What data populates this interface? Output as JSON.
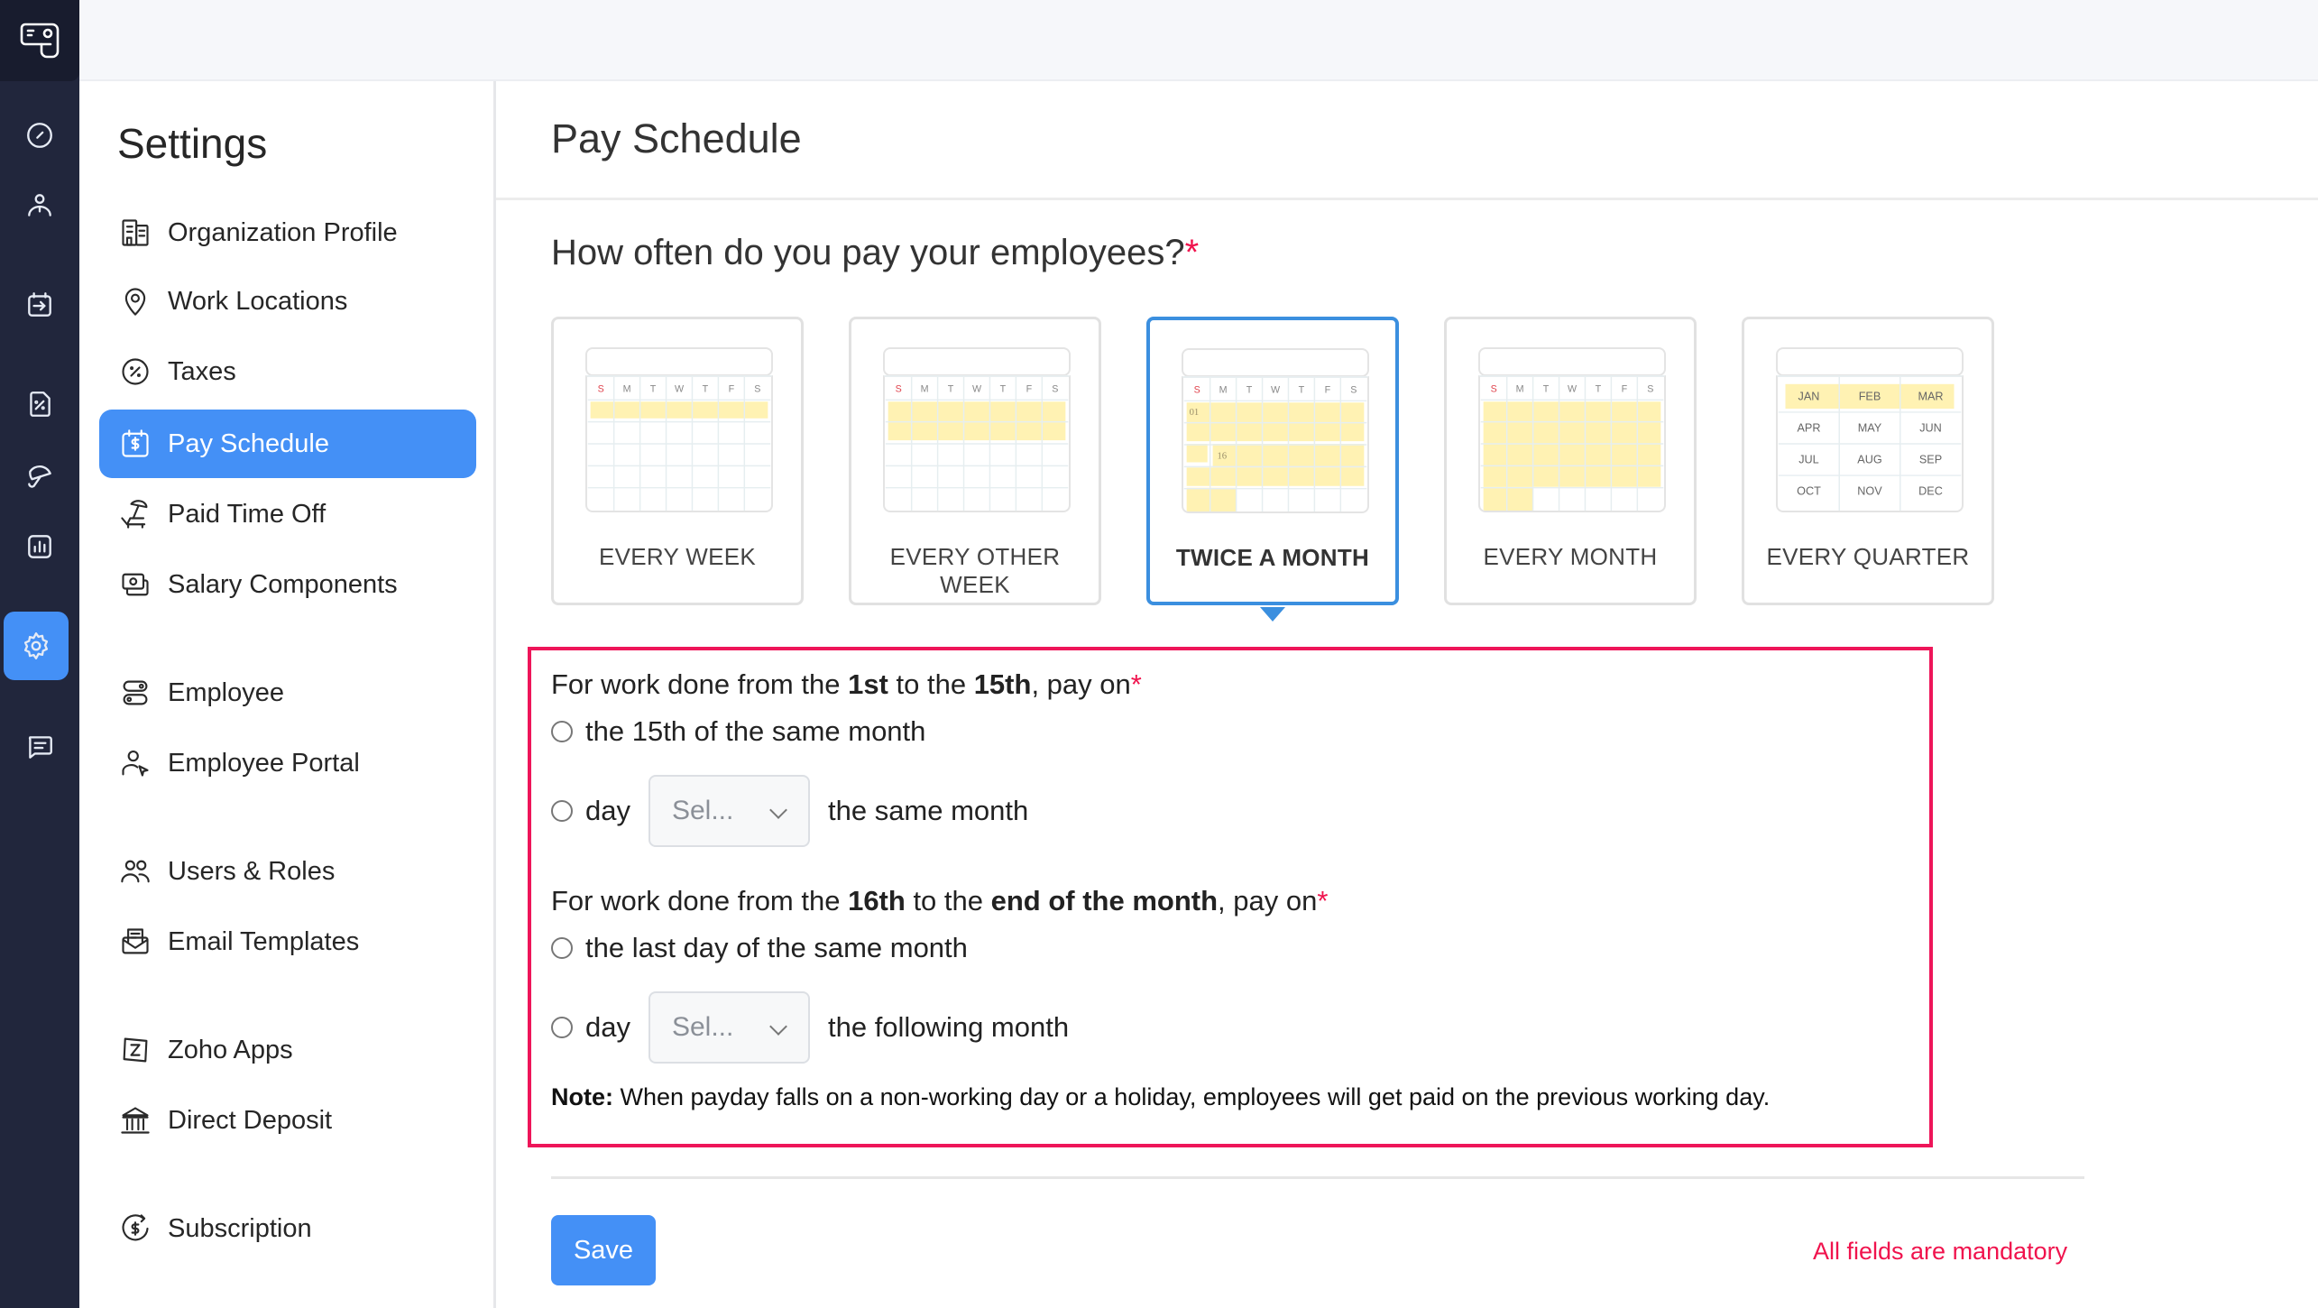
{
  "rail": {
    "logo": "payroll-logo-icon",
    "items": [
      {
        "icon": "dashboard-icon"
      },
      {
        "icon": "employees-icon"
      },
      {
        "icon": "pay-runs-icon"
      },
      {
        "icon": "tax-document-icon"
      },
      {
        "icon": "benefits-umbrella-icon"
      },
      {
        "icon": "reports-icon"
      },
      {
        "icon": "settings-gear-icon",
        "active": true
      },
      {
        "icon": "feedback-chat-icon"
      }
    ]
  },
  "settings": {
    "title": "Settings",
    "items": [
      {
        "label": "Organization Profile",
        "icon": "building-icon"
      },
      {
        "label": "Work Locations",
        "icon": "location-pin-icon"
      },
      {
        "label": "Taxes",
        "icon": "percent-circle-icon"
      },
      {
        "label": "Pay Schedule",
        "icon": "calendar-dollar-icon",
        "active": true
      },
      {
        "label": "Paid Time Off",
        "icon": "beach-chair-icon"
      },
      {
        "label": "Salary Components",
        "icon": "money-icon"
      },
      {
        "label": "Employee",
        "icon": "toggle-icon"
      },
      {
        "label": "Employee Portal",
        "icon": "user-pointer-icon"
      },
      {
        "label": "Users & Roles",
        "icon": "users-icon"
      },
      {
        "label": "Email Templates",
        "icon": "email-template-icon"
      },
      {
        "label": "Zoho Apps",
        "icon": "zoho-icon"
      },
      {
        "label": "Direct Deposit",
        "icon": "bank-icon"
      },
      {
        "label": "Subscription",
        "icon": "subscription-icon"
      }
    ]
  },
  "page": {
    "title": "Pay Schedule",
    "question": "How often do you pay your employees?",
    "required_mark": "*"
  },
  "frequencies": [
    {
      "label": "EVERY WEEK",
      "selected": false
    },
    {
      "label": "EVERY OTHER WEEK",
      "selected": false
    },
    {
      "label": "TWICE A MONTH",
      "selected": true
    },
    {
      "label": "EVERY MONTH",
      "selected": false
    },
    {
      "label": "EVERY QUARTER",
      "selected": false
    }
  ],
  "calendar": {
    "weekdays": [
      "S",
      "M",
      "T",
      "W",
      "T",
      "F",
      "S"
    ],
    "marker_first": "01",
    "marker_mid": "16",
    "months": [
      "JAN",
      "FEB",
      "MAR",
      "APR",
      "MAY",
      "JUN",
      "JUL",
      "AUG",
      "SEP",
      "OCT",
      "NOV",
      "DEC"
    ]
  },
  "form": {
    "first_period": {
      "q_prefix": "For work done from the ",
      "q_b1": "1st",
      "q_mid": " to the ",
      "q_b2": "15th",
      "q_suffix": ", pay on",
      "option1": "the 15th of the same month",
      "option2_prefix": "day",
      "select_placeholder": "Sel...",
      "option2_suffix": "the same month"
    },
    "second_period": {
      "q_prefix": "For work done from the ",
      "q_b1": "16th",
      "q_mid": " to the ",
      "q_b2": "end of the month",
      "q_suffix": ", pay on",
      "option1": "the last day of the same month",
      "option2_prefix": "day",
      "select_placeholder": "Sel...",
      "option2_suffix": "the following month"
    },
    "note_label": "Note:",
    "note_text": " When payday falls on a non-working day or a holiday, employees will get paid on the previous working day."
  },
  "footer": {
    "save_label": "Save",
    "mandatory_text": "All fields are mandatory"
  },
  "colors": {
    "accent": "#4490f6",
    "selected_border": "#3b8fdf",
    "required": "#f0134d",
    "rail_bg": "#21263c",
    "highlight": "#fff2b3"
  }
}
